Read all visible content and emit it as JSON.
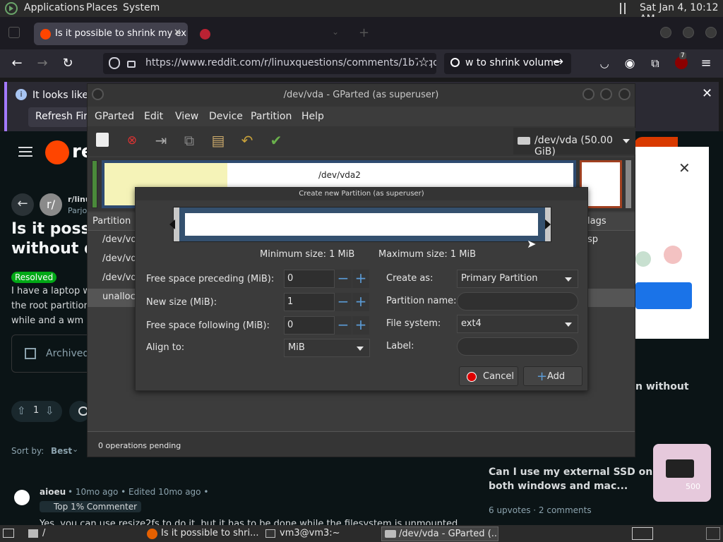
{
  "top_panel": {
    "applications": "Applications",
    "places": "Places",
    "system": "System",
    "clock": "Sat Jan  4, 10:12 AM"
  },
  "browser": {
    "tabs": [
      {
        "label": "Is it possible to shrink my ex"
      },
      {
        "label": ""
      }
    ],
    "url": "https://www.reddit.com/r/linuxquestions/comments/1b7vqo",
    "search": "w to shrink volume",
    "notification": "It looks like yo",
    "notification_button": "Refresh Fir",
    "extension_badge": "7"
  },
  "reddit": {
    "logo_text": "re",
    "subreddit": "r/linu",
    "author": "Parjo",
    "post_title_line1": "Is it possi",
    "post_title_line2": "without d",
    "resolved_label": "Resolved",
    "body_line1": "I have a laptop w",
    "body_line2": "the root partition",
    "body_line3": "while and a wm w",
    "archived_label": "Archived",
    "votes": "1",
    "sort_label": "Sort by:",
    "sort_value": "Best",
    "comment_author": "aioeu",
    "comment_meta": "• 10mo ago • Edited 10mo ago •",
    "comment_badge": "Top 1% Commenter",
    "comment_text": "Yes, you can use  resize2fs   to do it, but it has to be done while the filesystem is unmounted",
    "sidebar_partial": "n without",
    "related_title_line1": "Can I use my external SSD on",
    "related_title_line2": "both windows and mac...",
    "related_meta": "6 upvotes  ·  2 comments",
    "ssd_label": "500"
  },
  "gparted": {
    "title": "/dev/vda - GParted (as superuser)",
    "menu": [
      "GParted",
      "Edit",
      "View",
      "Device",
      "Partition",
      "Help"
    ],
    "device_selector": "/dev/vda (50.00 GiB)",
    "graph_partition_label": "/dev/vda2",
    "list_header_partition": "Partition",
    "list_header_flags": "lags",
    "list_rows": [
      "/dev/vd",
      "/dev/vd",
      "/dev/vd",
      "unalloca"
    ],
    "flags_value": "sp",
    "status": "0 operations pending"
  },
  "dialog": {
    "title": "Create new Partition (as superuser)",
    "min_size": "Minimum size: 1 MiB",
    "max_size": "Maximum size: 1 MiB",
    "free_preceding_label": "Free space preceding (MiB):",
    "free_preceding_value": "0",
    "new_size_label": "New size (MiB):",
    "new_size_value": "1",
    "free_following_label": "Free space following (MiB):",
    "free_following_value": "0",
    "align_label": "Align to:",
    "align_value": "MiB",
    "create_as_label": "Create as:",
    "create_as_value": "Primary Partition",
    "partition_name_label": "Partition name:",
    "file_system_label": "File system:",
    "file_system_value": "ext4",
    "label_label": "Label:",
    "cancel_label": "Cancel",
    "add_label": "Add"
  },
  "taskbar": {
    "folder_label": "/",
    "tasks": [
      "Is it possible to shri...",
      "vm3@vm3:~",
      "/dev/vda - GParted (..."
    ]
  },
  "colors": {
    "accent_blue": "#5b9bd5",
    "reddit_orange": "#ff4500",
    "resolved_green": "#01a816"
  }
}
